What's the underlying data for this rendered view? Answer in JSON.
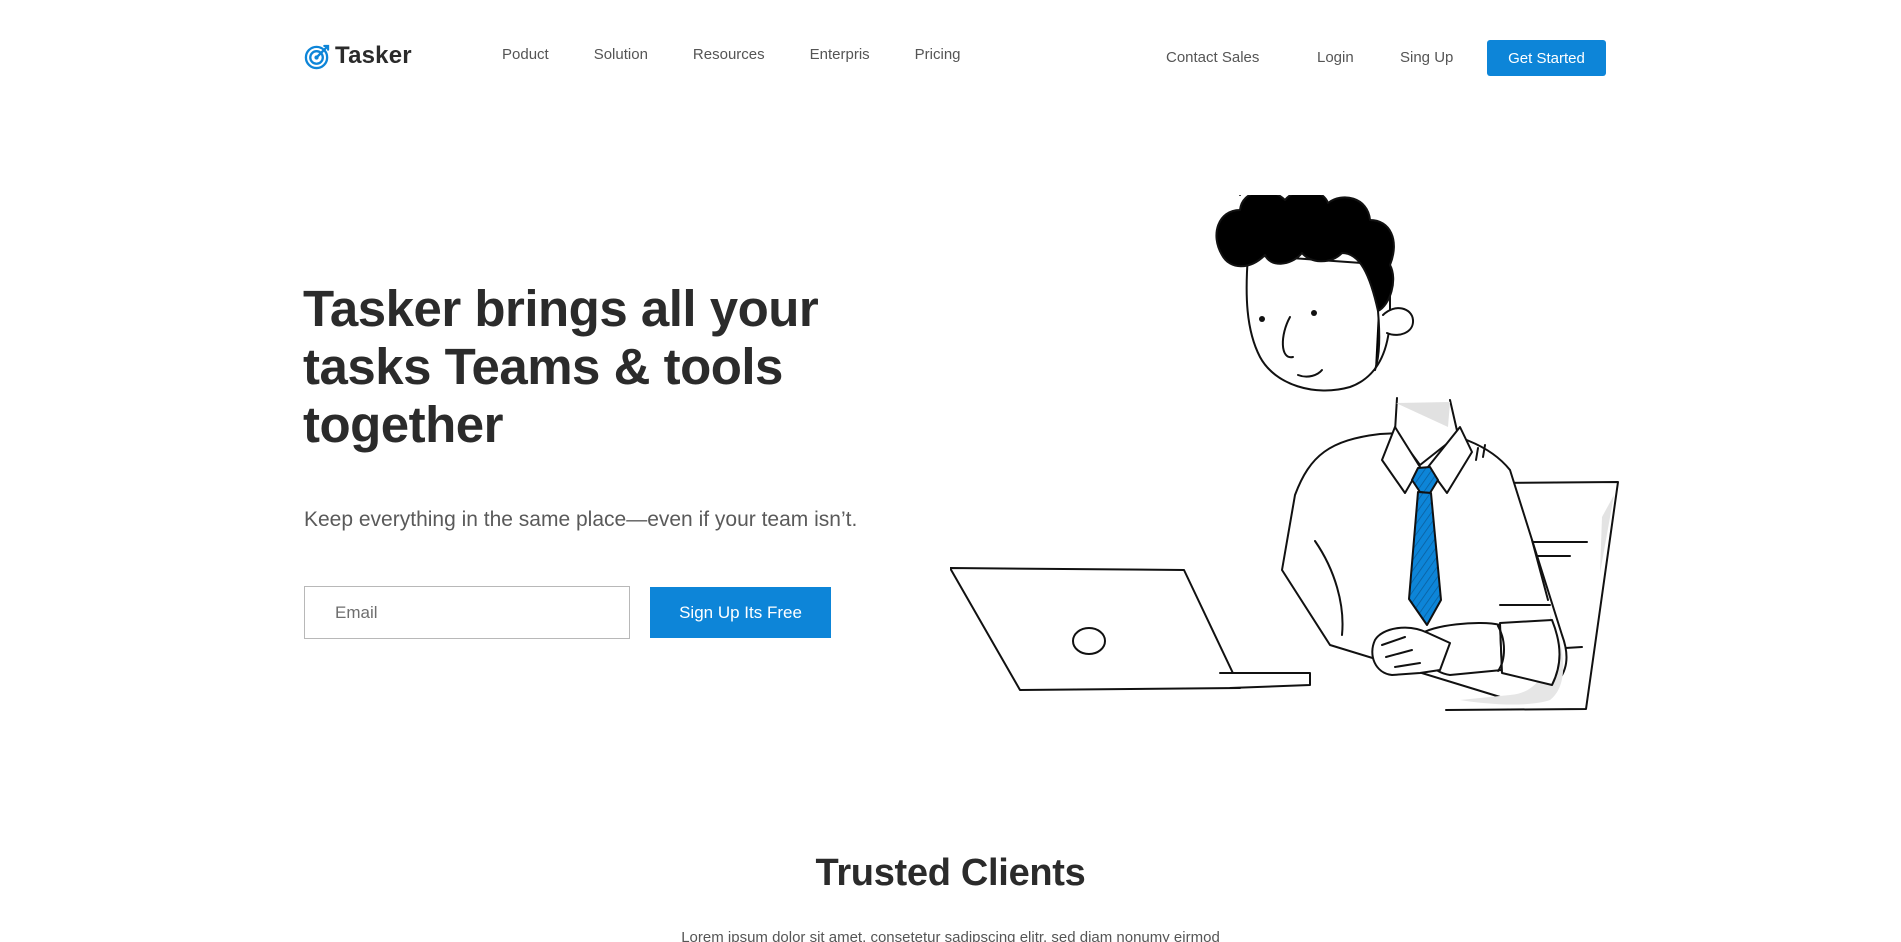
{
  "brand": {
    "name": "Tasker",
    "accent": "#0d85d8"
  },
  "nav": {
    "links": [
      "Poduct",
      "Solution",
      "Resources",
      "Enterpris",
      "Pricing"
    ],
    "contact_sales": "Contact Sales",
    "login": "Login",
    "signup": "Sing Up",
    "get_started": "Get Started"
  },
  "hero": {
    "title": "Tasker brings all your tasks Teams & tools together",
    "subtitle": "Keep everything in the same place—even if your team isn’t.",
    "email_placeholder": "Email",
    "email_value": "",
    "cta": "Sign Up Its Free"
  },
  "clients": {
    "title": "Trusted Clients",
    "text": "Lorem ipsum dolor sit amet, consetetur sadipscing elitr, sed diam nonumy eirmod"
  },
  "icons": {
    "logo": "target-icon"
  }
}
